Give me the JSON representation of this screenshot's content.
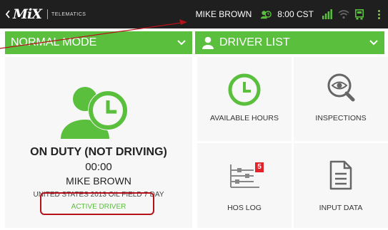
{
  "topbar": {
    "logo_text": "MiX",
    "logo_sub": "TELEMATICS",
    "driver_name": "MIKE BROWN",
    "time": "8:00 CST",
    "icons": [
      "back-icon",
      "clock-icon",
      "signal-icon",
      "wifi-icon",
      "device-icon",
      "more-icon"
    ]
  },
  "left_header": {
    "title": "NORMAL MODE"
  },
  "right_header": {
    "title": "DRIVER LIST"
  },
  "status": {
    "title": "ON DUTY (NOT DRIVING)",
    "time": "00:00",
    "driver": "MIKE BROWN",
    "ruleset": "UNITED STATES 2013 OIL FIELD 7 DAY",
    "active": "ACTIVE DRIVER"
  },
  "tiles": [
    {
      "label": "AVAILABLE HOURS",
      "icon": "clock-icon"
    },
    {
      "label": "INSPECTIONS",
      "icon": "eye-magnifier-icon"
    },
    {
      "label": "HOS LOG",
      "icon": "hos-log-icon",
      "badge": "5"
    },
    {
      "label": "INPUT DATA",
      "icon": "document-icon"
    }
  ],
  "colors": {
    "accent": "#5bbf3e",
    "topbar": "#1f1f1f",
    "annotation": "#b5121b",
    "badge": "#e0222b"
  }
}
